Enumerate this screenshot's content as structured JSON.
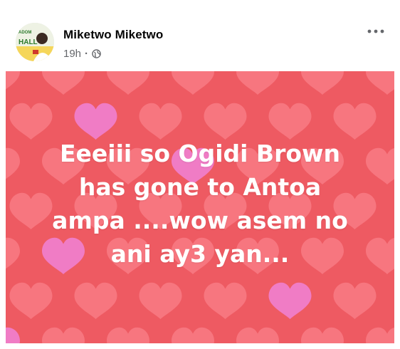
{
  "post": {
    "author": "Miketwo Miketwo",
    "time": "19h",
    "separator": "·",
    "privacy_icon": "globe-icon",
    "more_icon": "more-options-icon",
    "avatar_text": {
      "line1": "ADOM",
      "line2": "HALL"
    },
    "text_lines": [
      "Eeeiii so Ogidi Brown",
      "has gone to Antoa",
      "ampa ....wow asem no",
      "ani ay3 yan..."
    ],
    "background": {
      "theme": "hearts",
      "base_color": "#ee5a62",
      "heart_color": "#f98089",
      "accent_heart_color": "#ef7fd0"
    }
  }
}
